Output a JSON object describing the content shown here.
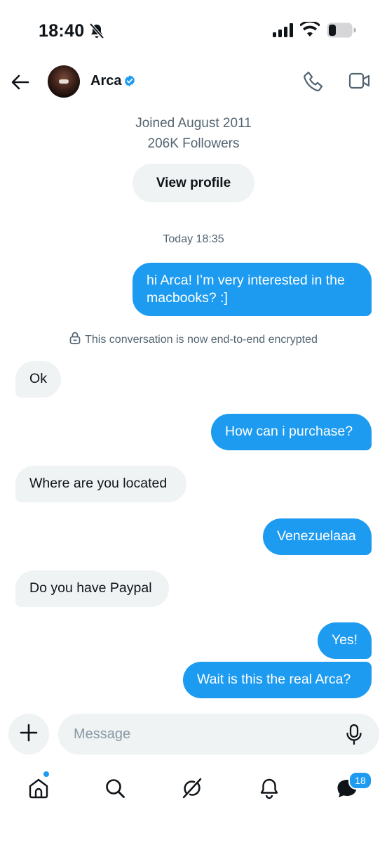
{
  "status_bar": {
    "time": "18:40"
  },
  "header": {
    "name": "Arca"
  },
  "profile": {
    "joined": "Joined August 2011",
    "followers": "206K Followers",
    "view_profile_label": "View profile"
  },
  "conversation": {
    "timestamp": "Today 18:35",
    "encryption_note": "This conversation is now end-to-end encrypted",
    "messages": [
      {
        "from": "me",
        "text": "hi Arca! I’m very interested in the macbooks? :]"
      },
      {
        "from": "them",
        "text": "Ok"
      },
      {
        "from": "me",
        "text": "How can i purchase?"
      },
      {
        "from": "them",
        "text": "Where are you located"
      },
      {
        "from": "me",
        "text": "Venezuelaaa"
      },
      {
        "from": "them",
        "text": "Do you have Paypal"
      },
      {
        "from": "me",
        "text": "Yes!"
      },
      {
        "from": "me",
        "text": "Wait is this the real Arca?"
      }
    ]
  },
  "composer": {
    "placeholder": "Message"
  },
  "bottom_nav": {
    "messages_badge": "18"
  },
  "colors": {
    "accent": "#1d9bf0",
    "received_bubble": "#eff3f4",
    "muted_text": "#536471"
  },
  "icons": [
    "bell-off-icon",
    "signal-icon",
    "wifi-icon",
    "battery-icon",
    "back-arrow-icon",
    "verified-badge-icon",
    "phone-icon",
    "video-icon",
    "lock-icon",
    "plus-icon",
    "mic-icon",
    "home-icon",
    "search-icon",
    "grok-icon",
    "bell-icon",
    "messages-icon"
  ]
}
